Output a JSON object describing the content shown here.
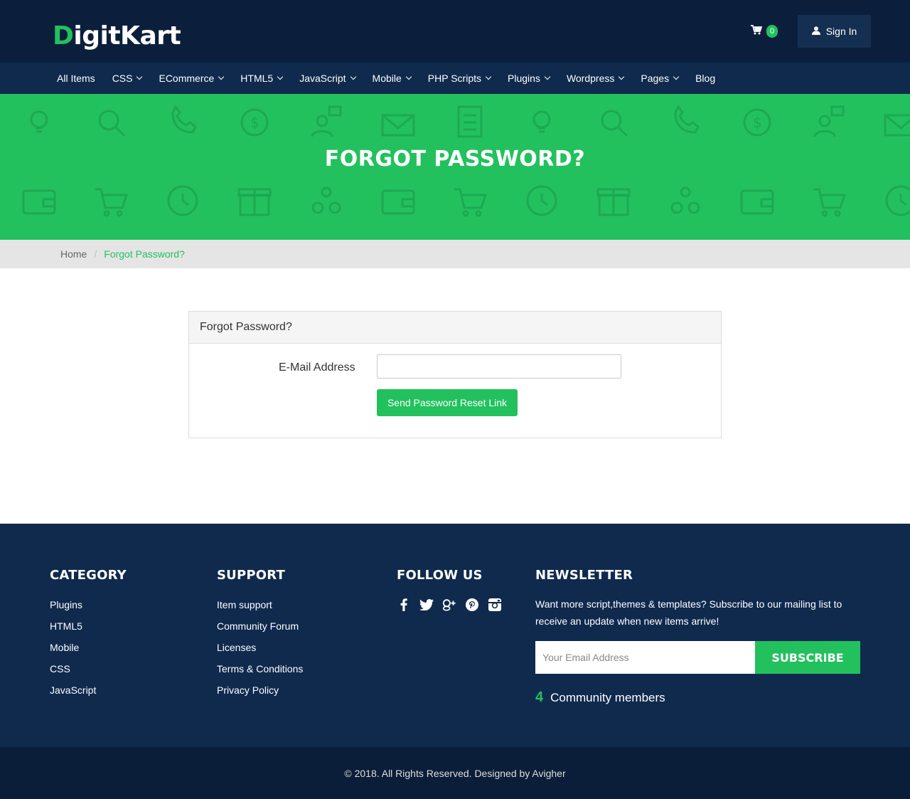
{
  "brand": {
    "logo_first": "D",
    "logo_rest": "igitKart"
  },
  "header": {
    "cart_count": "0",
    "signin_label": "Sign In"
  },
  "nav": {
    "items": [
      {
        "label": "All Items",
        "dropdown": false
      },
      {
        "label": "CSS",
        "dropdown": true
      },
      {
        "label": "ECommerce",
        "dropdown": true
      },
      {
        "label": "HTML5",
        "dropdown": true
      },
      {
        "label": "JavaScript",
        "dropdown": true
      },
      {
        "label": "Mobile",
        "dropdown": true
      },
      {
        "label": "PHP Scripts",
        "dropdown": true
      },
      {
        "label": "Plugins",
        "dropdown": true
      },
      {
        "label": "Wordpress",
        "dropdown": true
      },
      {
        "label": "Pages",
        "dropdown": true
      },
      {
        "label": "Blog",
        "dropdown": false
      }
    ]
  },
  "hero": {
    "title": "FORGOT PASSWORD?"
  },
  "breadcrumb": {
    "home": "Home",
    "separator": "/",
    "current": "Forgot Password?"
  },
  "form": {
    "panel_title": "Forgot Password?",
    "email_label": "E-Mail Address",
    "email_value": "",
    "submit_label": "Send Password Reset Link"
  },
  "footer": {
    "category": {
      "title": "CATEGORY",
      "links": [
        "Plugins",
        "HTML5",
        "Mobile",
        "CSS",
        "JavaScript"
      ]
    },
    "support": {
      "title": "SUPPORT",
      "links": [
        "Item support",
        "Community Forum",
        "Licenses",
        "Terms & Conditions",
        "Privacy Policy"
      ]
    },
    "follow": {
      "title": "FOLLOW US",
      "icons": [
        "facebook-icon",
        "twitter-icon",
        "google-plus-icon",
        "pinterest-icon",
        "instagram-icon"
      ]
    },
    "newsletter": {
      "title": "NEWSLETTER",
      "text": "Want more script,themes & templates? Subscribe to our mailing list to receive an update when new items arrive!",
      "placeholder": "Your Email Address",
      "button": "SUBSCRIBE",
      "community_count": "4",
      "community_label": "Community members"
    },
    "copyright": "© 2018. All Rights Reserved. Designed by Avigher"
  },
  "colors": {
    "brand_green": "#22c15e",
    "header_navy": "#0b1f3d",
    "nav_navy": "#0f2a4d"
  }
}
